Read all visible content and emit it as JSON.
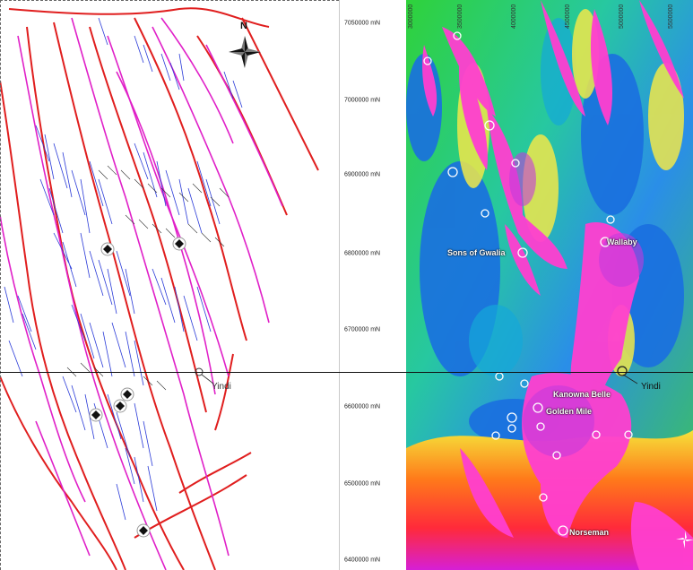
{
  "map": {
    "north_label": "N",
    "northings": [
      "7050000 mN",
      "7000000 mN",
      "6900000 mN",
      "6800000 mN",
      "6700000 mN",
      "6600000 mN",
      "6500000 mN",
      "6400000 mN"
    ],
    "eastings_top": [
      "3000000",
      "3500000",
      "4000000",
      "4500000",
      "5000000",
      "5500000"
    ],
    "left_labels": {
      "yindi": "Yindi"
    },
    "right_labels": {
      "sons_of_gwalia": "Sons of Gwalia",
      "wallaby": "Wallaby",
      "kanowna_belle": "Kanowna Belle",
      "golden_mile": "Golden Mile",
      "yindi": "Yindi",
      "norseman": "Norseman"
    },
    "colors": {
      "fault_major": "#e01e1e",
      "fault_minor": "#e020c8",
      "lineament": "#2b3bd8",
      "mag_low": "#1a6fe0",
      "mag_mid": "#2fd23a",
      "mag_high": "#ff3fd0"
    },
    "icons": [
      "north-arrow-icon",
      "mine-diamond-icon",
      "deposit-circle-icon"
    ]
  }
}
